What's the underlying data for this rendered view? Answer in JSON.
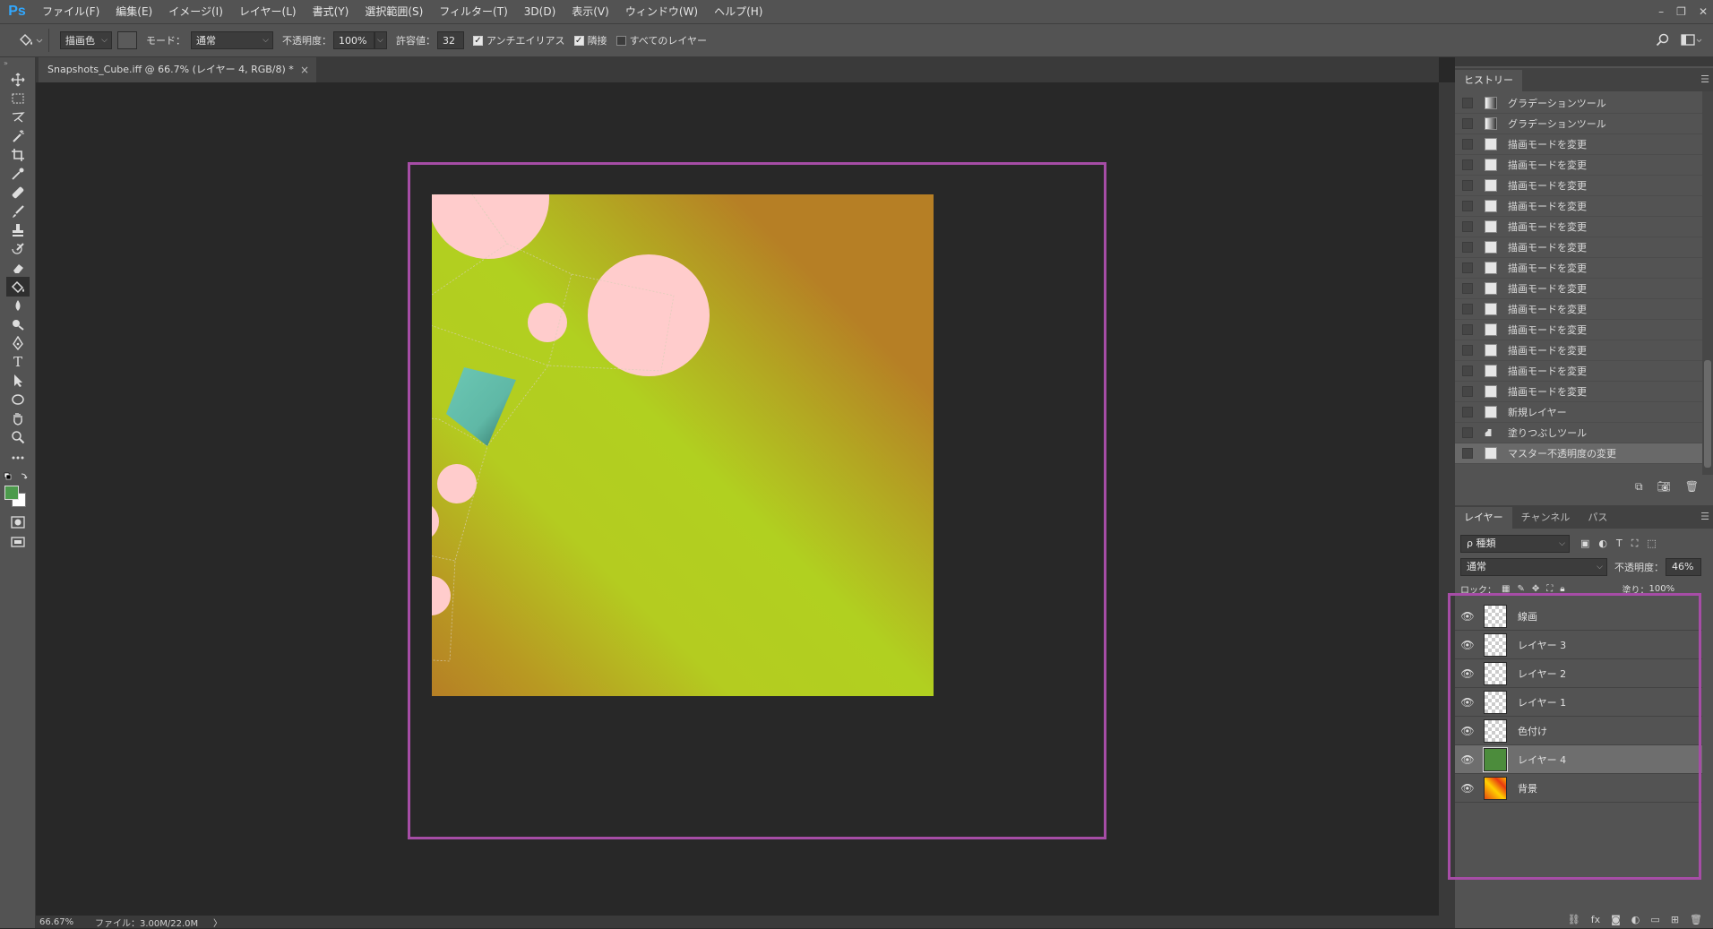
{
  "app": {
    "logo": "Ps",
    "menu": [
      "ファイル(F)",
      "編集(E)",
      "イメージ(I)",
      "レイヤー(L)",
      "書式(Y)",
      "選択範囲(S)",
      "フィルター(T)",
      "3D(D)",
      "表示(V)",
      "ウィンドウ(W)",
      "ヘルプ(H)"
    ],
    "window_controls": {
      "minimize": "–",
      "restore": "❐",
      "close": "✕"
    }
  },
  "options": {
    "fill_source": "描画色",
    "mode_label": "モード：",
    "mode_value": "通常",
    "opacity_label": "不透明度：",
    "opacity_value": "100%",
    "tolerance_label": "許容値：",
    "tolerance_value": "32",
    "antialias_label": "アンチエイリアス",
    "antialias_checked": true,
    "contiguous_label": "隣接",
    "contiguous_checked": true,
    "all_layers_label": "すべてのレイヤー",
    "all_layers_checked": false
  },
  "document": {
    "tab_title": "Snapshots_Cube.iff @ 66.7% (レイヤー 4, RGB/8) *",
    "close": "×"
  },
  "status": {
    "zoom": "66.67%",
    "file_info": "ファイル：3.00M/22.0M",
    "arrow": "〉"
  },
  "history": {
    "tab": "ヒストリー",
    "items": [
      {
        "label": "グラデーションツール",
        "icon": "gradient-icon"
      },
      {
        "label": "グラデーションツール",
        "icon": "gradient-icon"
      },
      {
        "label": "描画モードを変更",
        "icon": "document-icon"
      },
      {
        "label": "描画モードを変更",
        "icon": "document-icon"
      },
      {
        "label": "描画モードを変更",
        "icon": "document-icon"
      },
      {
        "label": "描画モードを変更",
        "icon": "document-icon"
      },
      {
        "label": "描画モードを変更",
        "icon": "document-icon"
      },
      {
        "label": "描画モードを変更",
        "icon": "document-icon"
      },
      {
        "label": "描画モードを変更",
        "icon": "document-icon"
      },
      {
        "label": "描画モードを変更",
        "icon": "document-icon"
      },
      {
        "label": "描画モードを変更",
        "icon": "document-icon"
      },
      {
        "label": "描画モードを変更",
        "icon": "document-icon"
      },
      {
        "label": "描画モードを変更",
        "icon": "document-icon"
      },
      {
        "label": "描画モードを変更",
        "icon": "document-icon"
      },
      {
        "label": "描画モードを変更",
        "icon": "document-icon"
      },
      {
        "label": "新規レイヤー",
        "icon": "document-icon"
      },
      {
        "label": "塗りつぶしツール",
        "icon": "paint-bucket-icon"
      },
      {
        "label": "マスター不透明度の変更",
        "icon": "document-icon",
        "current": true
      }
    ]
  },
  "layers_panel": {
    "tabs": [
      "レイヤー",
      "チャンネル",
      "パス"
    ],
    "filter": "ρ 種類",
    "blend_mode": "通常",
    "opacity_label": "不透明度：",
    "opacity_value": "46%",
    "lock_label": "ロック：",
    "fill_label": "塗り：",
    "fill_value": "100%",
    "layers": [
      {
        "name": "線画",
        "thumb": "transparent"
      },
      {
        "name": "レイヤー 3",
        "thumb": "transparent"
      },
      {
        "name": "レイヤー 2",
        "thumb": "transparent"
      },
      {
        "name": "レイヤー 1",
        "thumb": "transparent"
      },
      {
        "name": "色付け",
        "thumb": "transparent"
      },
      {
        "name": "レイヤー 4",
        "thumb": "green",
        "selected": true
      },
      {
        "name": "背景",
        "thumb": "gradient"
      }
    ]
  },
  "colors": {
    "highlight": "#a64da6",
    "foreground": "#4c9a4c",
    "background": "#ffffff",
    "circles": "#ffcccc",
    "cube": "#6cc8b4",
    "canvas_gold": "#b67f25",
    "canvas_green": "#b1d020",
    "layer4_thumb": "#4c8c3c"
  }
}
